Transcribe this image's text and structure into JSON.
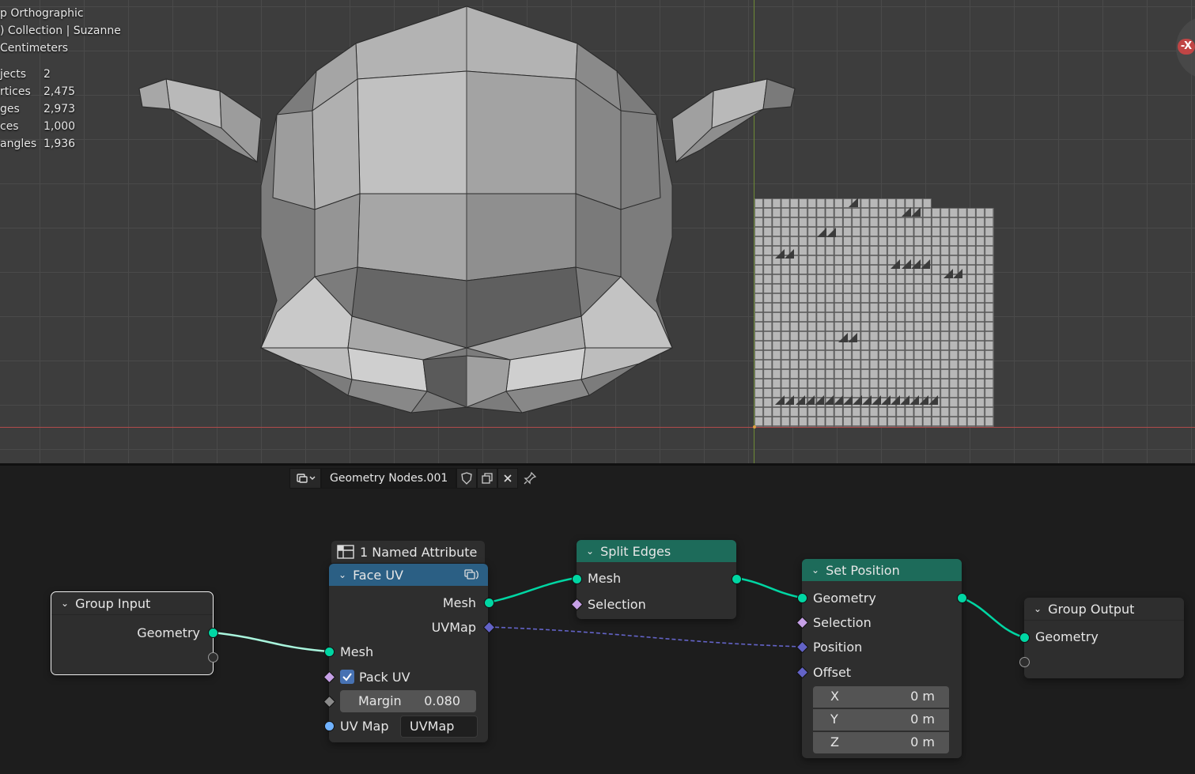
{
  "viewport": {
    "info_lines": [
      "p Orthographic",
      ") Collection | Suzanne",
      "  Centimeters"
    ],
    "stats": [
      {
        "label": "jects",
        "value": "2"
      },
      {
        "label": "rtices",
        "value": "2,475"
      },
      {
        "label": "ges",
        "value": "2,973"
      },
      {
        "label": "ces",
        "value": "1,000"
      },
      {
        "label": "angles",
        "value": "1,936"
      }
    ],
    "gizmo_label": "-X"
  },
  "editor_header": {
    "tree_name": "Geometry Nodes.001",
    "icons": [
      "node-tree-icon",
      "fake-user-shield-icon",
      "duplicate-icon",
      "close-icon",
      "pin-icon"
    ]
  },
  "nodes": {
    "group_input": {
      "title": "Group Input",
      "outputs": [
        "Geometry"
      ]
    },
    "face_uv": {
      "badge": "1 Named Attribute",
      "title": "Face UV",
      "outputs": [
        "Mesh",
        "UVMap"
      ],
      "inputs": {
        "mesh": "Mesh",
        "pack_uv": "Pack UV",
        "pack_uv_checked": true,
        "margin_label": "Margin",
        "margin_value": "0.080",
        "uv_map_label": "UV Map",
        "uv_map_value": "UVMap"
      }
    },
    "split_edges": {
      "title": "Split Edges",
      "inputs": [
        "Mesh",
        "Selection"
      ]
    },
    "set_position": {
      "title": "Set Position",
      "inputs": [
        "Geometry",
        "Selection",
        "Position",
        "Offset"
      ],
      "offset": [
        {
          "axis": "X",
          "value": "0 m"
        },
        {
          "axis": "Y",
          "value": "0 m"
        },
        {
          "axis": "Z",
          "value": "0 m"
        }
      ]
    },
    "group_output": {
      "title": "Group Output",
      "inputs": [
        "Geometry"
      ]
    }
  },
  "colors": {
    "geometry_socket": "#00d6a3",
    "vector_socket": "#6363c7",
    "face_uv_header": "#2b5f84",
    "geometry_header": "#1d6b5a",
    "checkbox": "#4772b3"
  }
}
